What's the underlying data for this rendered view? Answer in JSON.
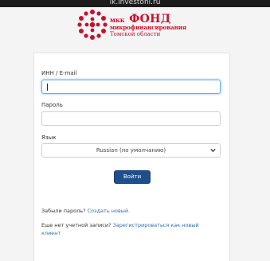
{
  "browser": {
    "url": "lk.investonl.ru"
  },
  "logo": {
    "prefix": "мкк",
    "name": "ФОНД",
    "line1": "микрофинансирования",
    "line2": "Томской области"
  },
  "form": {
    "login": {
      "label": "ИНН / E-mail",
      "value": ""
    },
    "password": {
      "label": "Пароль",
      "value": ""
    },
    "language": {
      "label": "Язык",
      "selected": "Russian (по умолчанию)"
    },
    "submit_label": "Войти"
  },
  "links": {
    "forgot_text": "Забыли пароль?",
    "forgot_link": "Создать новый.",
    "noaccount_text": "Еще нет учетной записи?",
    "register_link_1": "Зарегистрироваться как новый",
    "register_link_2": "клиент"
  },
  "colors": {
    "brand_red": "#c8102e",
    "button_blue": "#1f4e8c",
    "link_blue": "#2a6db3"
  }
}
